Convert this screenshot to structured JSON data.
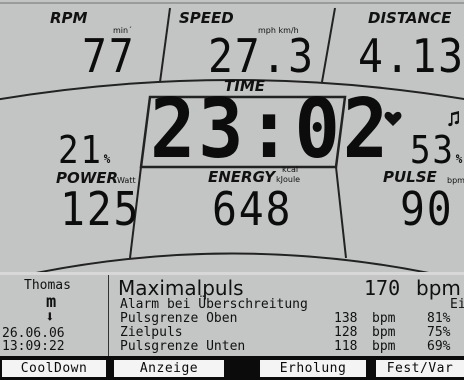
{
  "metrics": {
    "rpm": {
      "label": "RPM",
      "unit": "min´",
      "value": "77"
    },
    "speed": {
      "label": "SPEED",
      "unit": "mph km/h",
      "value": "27.3"
    },
    "distance": {
      "label": "DISTANCE",
      "value": "4.13"
    },
    "time": {
      "label": "TIME",
      "value": "23:02"
    },
    "power_percent": {
      "value": "21"
    },
    "power": {
      "label": "POWER",
      "unit": "Watt",
      "value": "125"
    },
    "energy": {
      "label": "ENERGY",
      "unit_top": "kcal",
      "unit_bottom": "kJoule",
      "value": "648"
    },
    "pulse_percent": {
      "value": "53"
    },
    "pulse": {
      "label": "PULSE",
      "unit": "bpm",
      "value": "90"
    },
    "percent_sign": "%"
  },
  "user": {
    "name": "Thomas",
    "gender_symbol": "m",
    "arrow": "⬇",
    "date": "26.06.06",
    "time": "13:09:22"
  },
  "detail": {
    "title": "Maximalpuls",
    "title_value": "170",
    "title_unit": "bpm",
    "rows": [
      {
        "label": "Alarm bei Überschreitung",
        "value": "",
        "unit": "",
        "extra": "Ein"
      },
      {
        "label": "Pulsgrenze Oben",
        "value": "138",
        "unit": "bpm",
        "extra": "81%"
      },
      {
        "label": "Zielpuls",
        "value": "128",
        "unit": "bpm",
        "extra": "75%"
      },
      {
        "label": "Pulsgrenze Unten",
        "value": "118",
        "unit": "bpm",
        "extra": "69%"
      }
    ]
  },
  "softkeys": [
    "CoolDown",
    "Anzeige",
    "Erholung",
    "Fest/Var"
  ],
  "colors": {
    "lcd": "#c3c5c4",
    "ink": "#111111",
    "bezel": "#0b0b0b",
    "key": "#f4f4f4"
  },
  "icons": [
    "heart-icon",
    "music-note-icon",
    "gender-male-icon",
    "down-arrow-icon"
  ]
}
